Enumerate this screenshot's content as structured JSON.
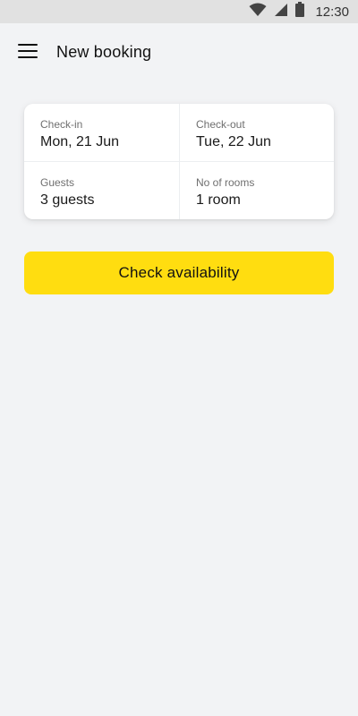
{
  "status_bar": {
    "time": "12:30",
    "icons": [
      "wifi-icon",
      "cellular-signal-icon",
      "battery-icon"
    ]
  },
  "app_bar": {
    "menu_icon": "hamburger-menu-icon",
    "title": "New booking"
  },
  "booking_form": {
    "check_in": {
      "label": "Check-in",
      "value": "Mon, 21 Jun"
    },
    "check_out": {
      "label": "Check-out",
      "value": "Tue, 22 Jun"
    },
    "guests": {
      "label": "Guests",
      "value": "3 guests"
    },
    "rooms": {
      "label": "No of rooms",
      "value": "1 room"
    }
  },
  "actions": {
    "check_availability_label": "Check availability"
  },
  "colors": {
    "background": "#f2f3f5",
    "status_bar": "#e1e1e1",
    "card": "#ffffff",
    "accent": "#ffdd10"
  }
}
